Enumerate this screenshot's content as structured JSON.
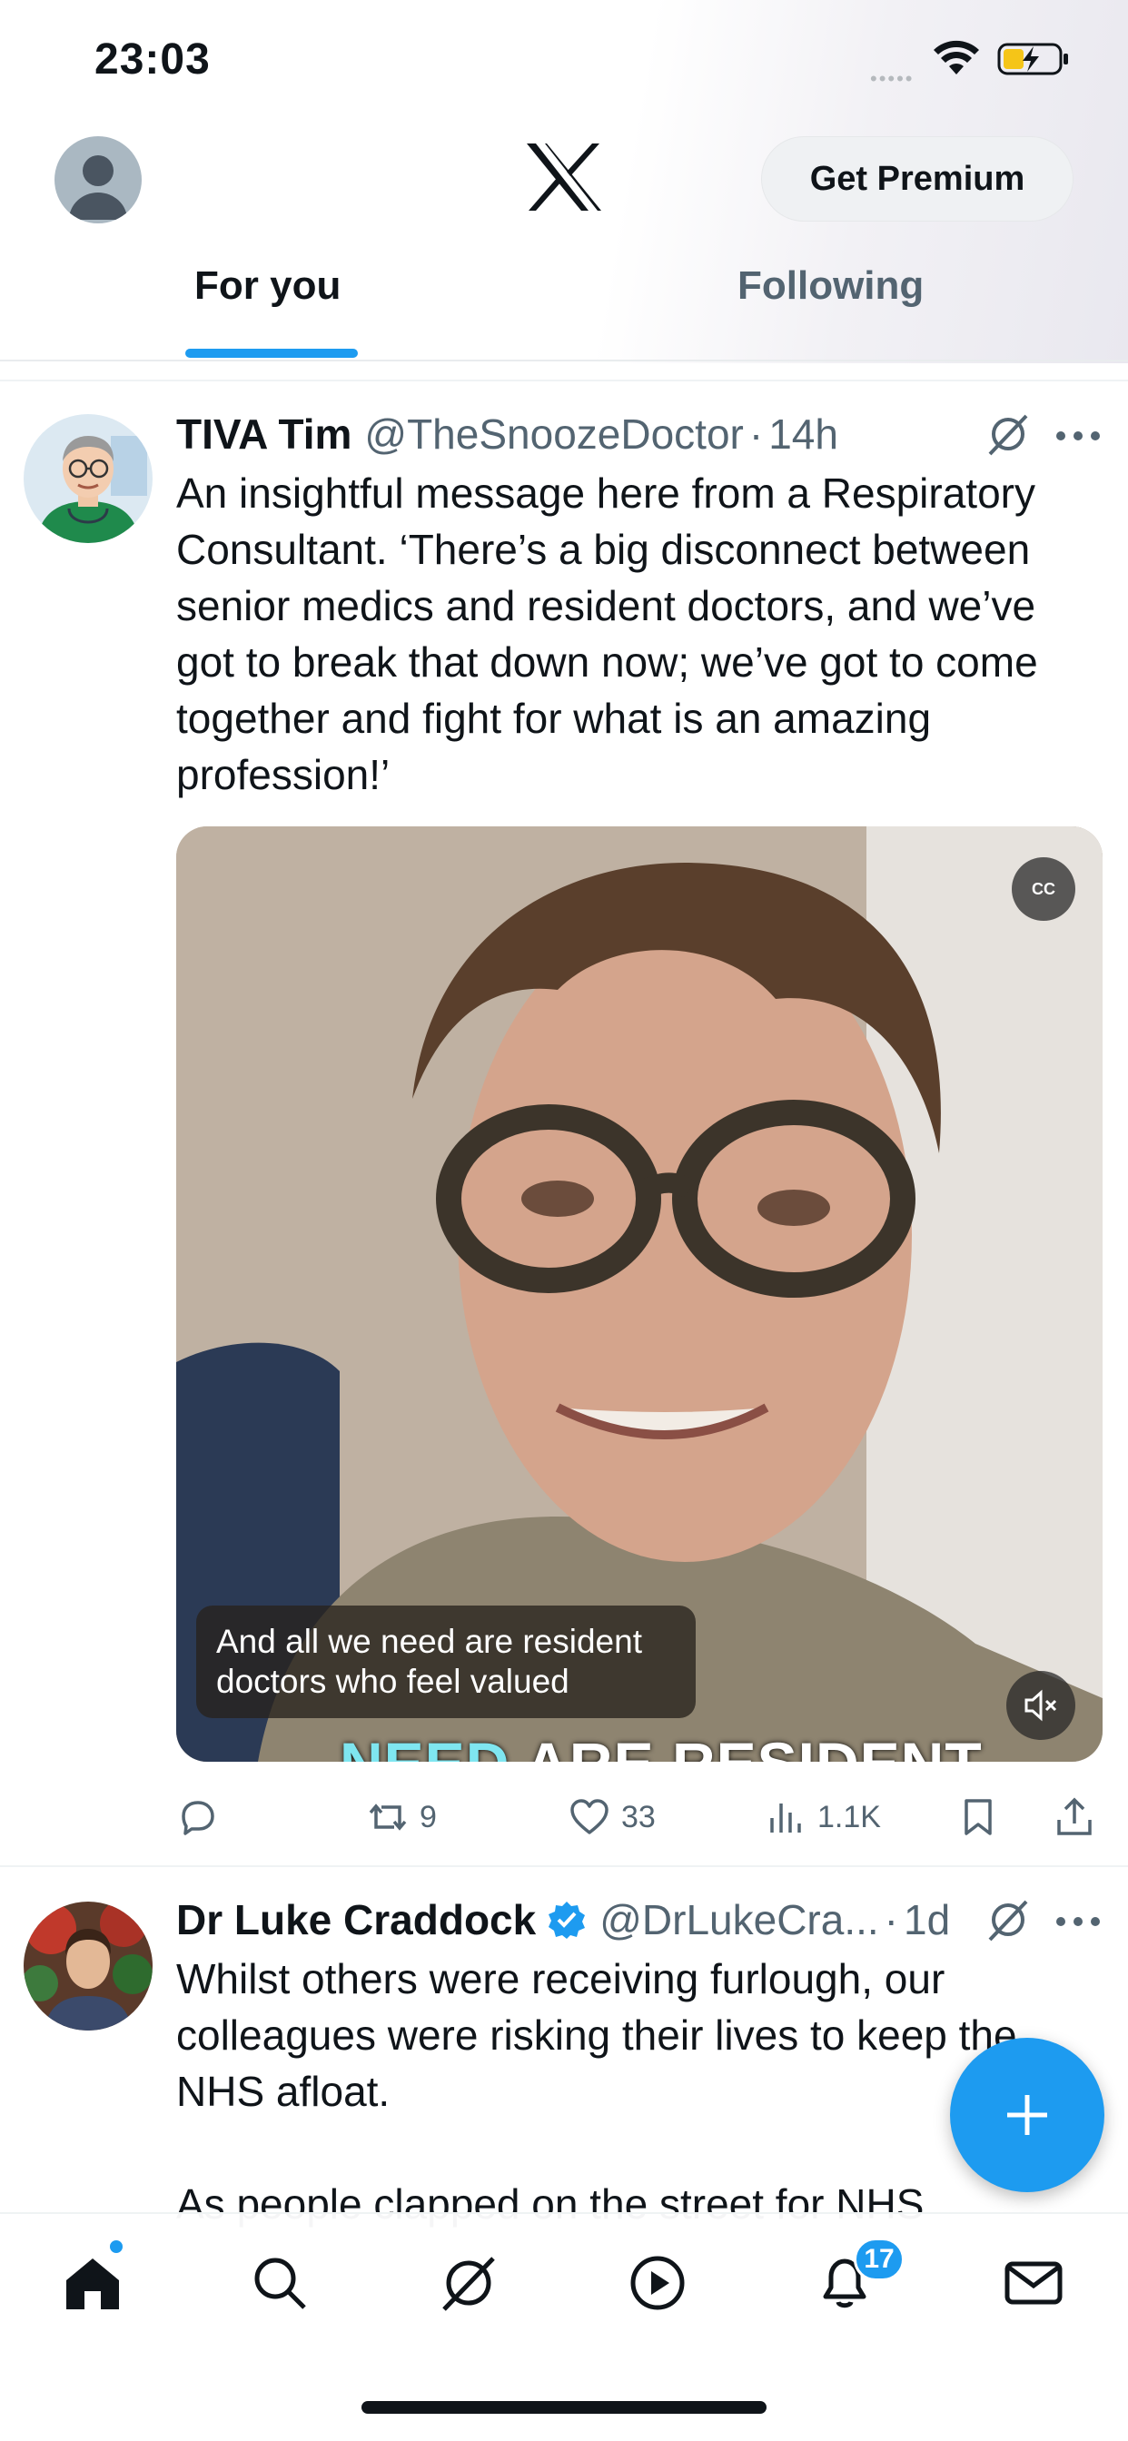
{
  "status_bar": {
    "time": "23:03",
    "signal_dots": "•••••",
    "icons": [
      "wifi-icon",
      "battery-charging-icon"
    ]
  },
  "header": {
    "logo": "x-logo",
    "premium_label": "Get Premium",
    "tabs": [
      {
        "label": "For you",
        "active": true
      },
      {
        "label": "Following",
        "active": false
      }
    ]
  },
  "tweets": [
    {
      "name": "TIVA Tim",
      "handle": "@TheSnoozeDoctor",
      "dot": "·",
      "time": "14h",
      "text": "An insightful message here from a Respiratory\nConsultant. ‘There’s a big disconnect between\nsenior medics and resident doctors, and we’ve\ngot to break that down now; we’ve got to come\ntogether and fight for what is an amazing\nprofession!’",
      "video": {
        "cc_label": "CC",
        "caption": "And all we need are resident doctors who feel valued",
        "burned_caption_highlight": "NEED",
        "burned_caption_rest": " ARE RESIDENT"
      },
      "actions": {
        "replies": "",
        "reposts": "9",
        "likes": "33",
        "views": "1.1K"
      }
    },
    {
      "name": "Dr Luke Craddock",
      "verified": true,
      "handle": "@DrLukeCra...",
      "dot": "·",
      "time": "1d",
      "text": "Whilst others were receiving furlough, our\ncolleagues were risking their lives to keep the\nNHS afloat.\n\nAs people clapped on the street for NHS"
    }
  ],
  "bottom_nav": {
    "items": [
      "home-icon",
      "search-icon",
      "grok-icon",
      "video-icon",
      "notifications-icon",
      "messages-icon"
    ],
    "notification_count": "17"
  },
  "colors": {
    "accent": "#1d9bf0",
    "text": "#0f1419",
    "secondary": "#536471"
  }
}
